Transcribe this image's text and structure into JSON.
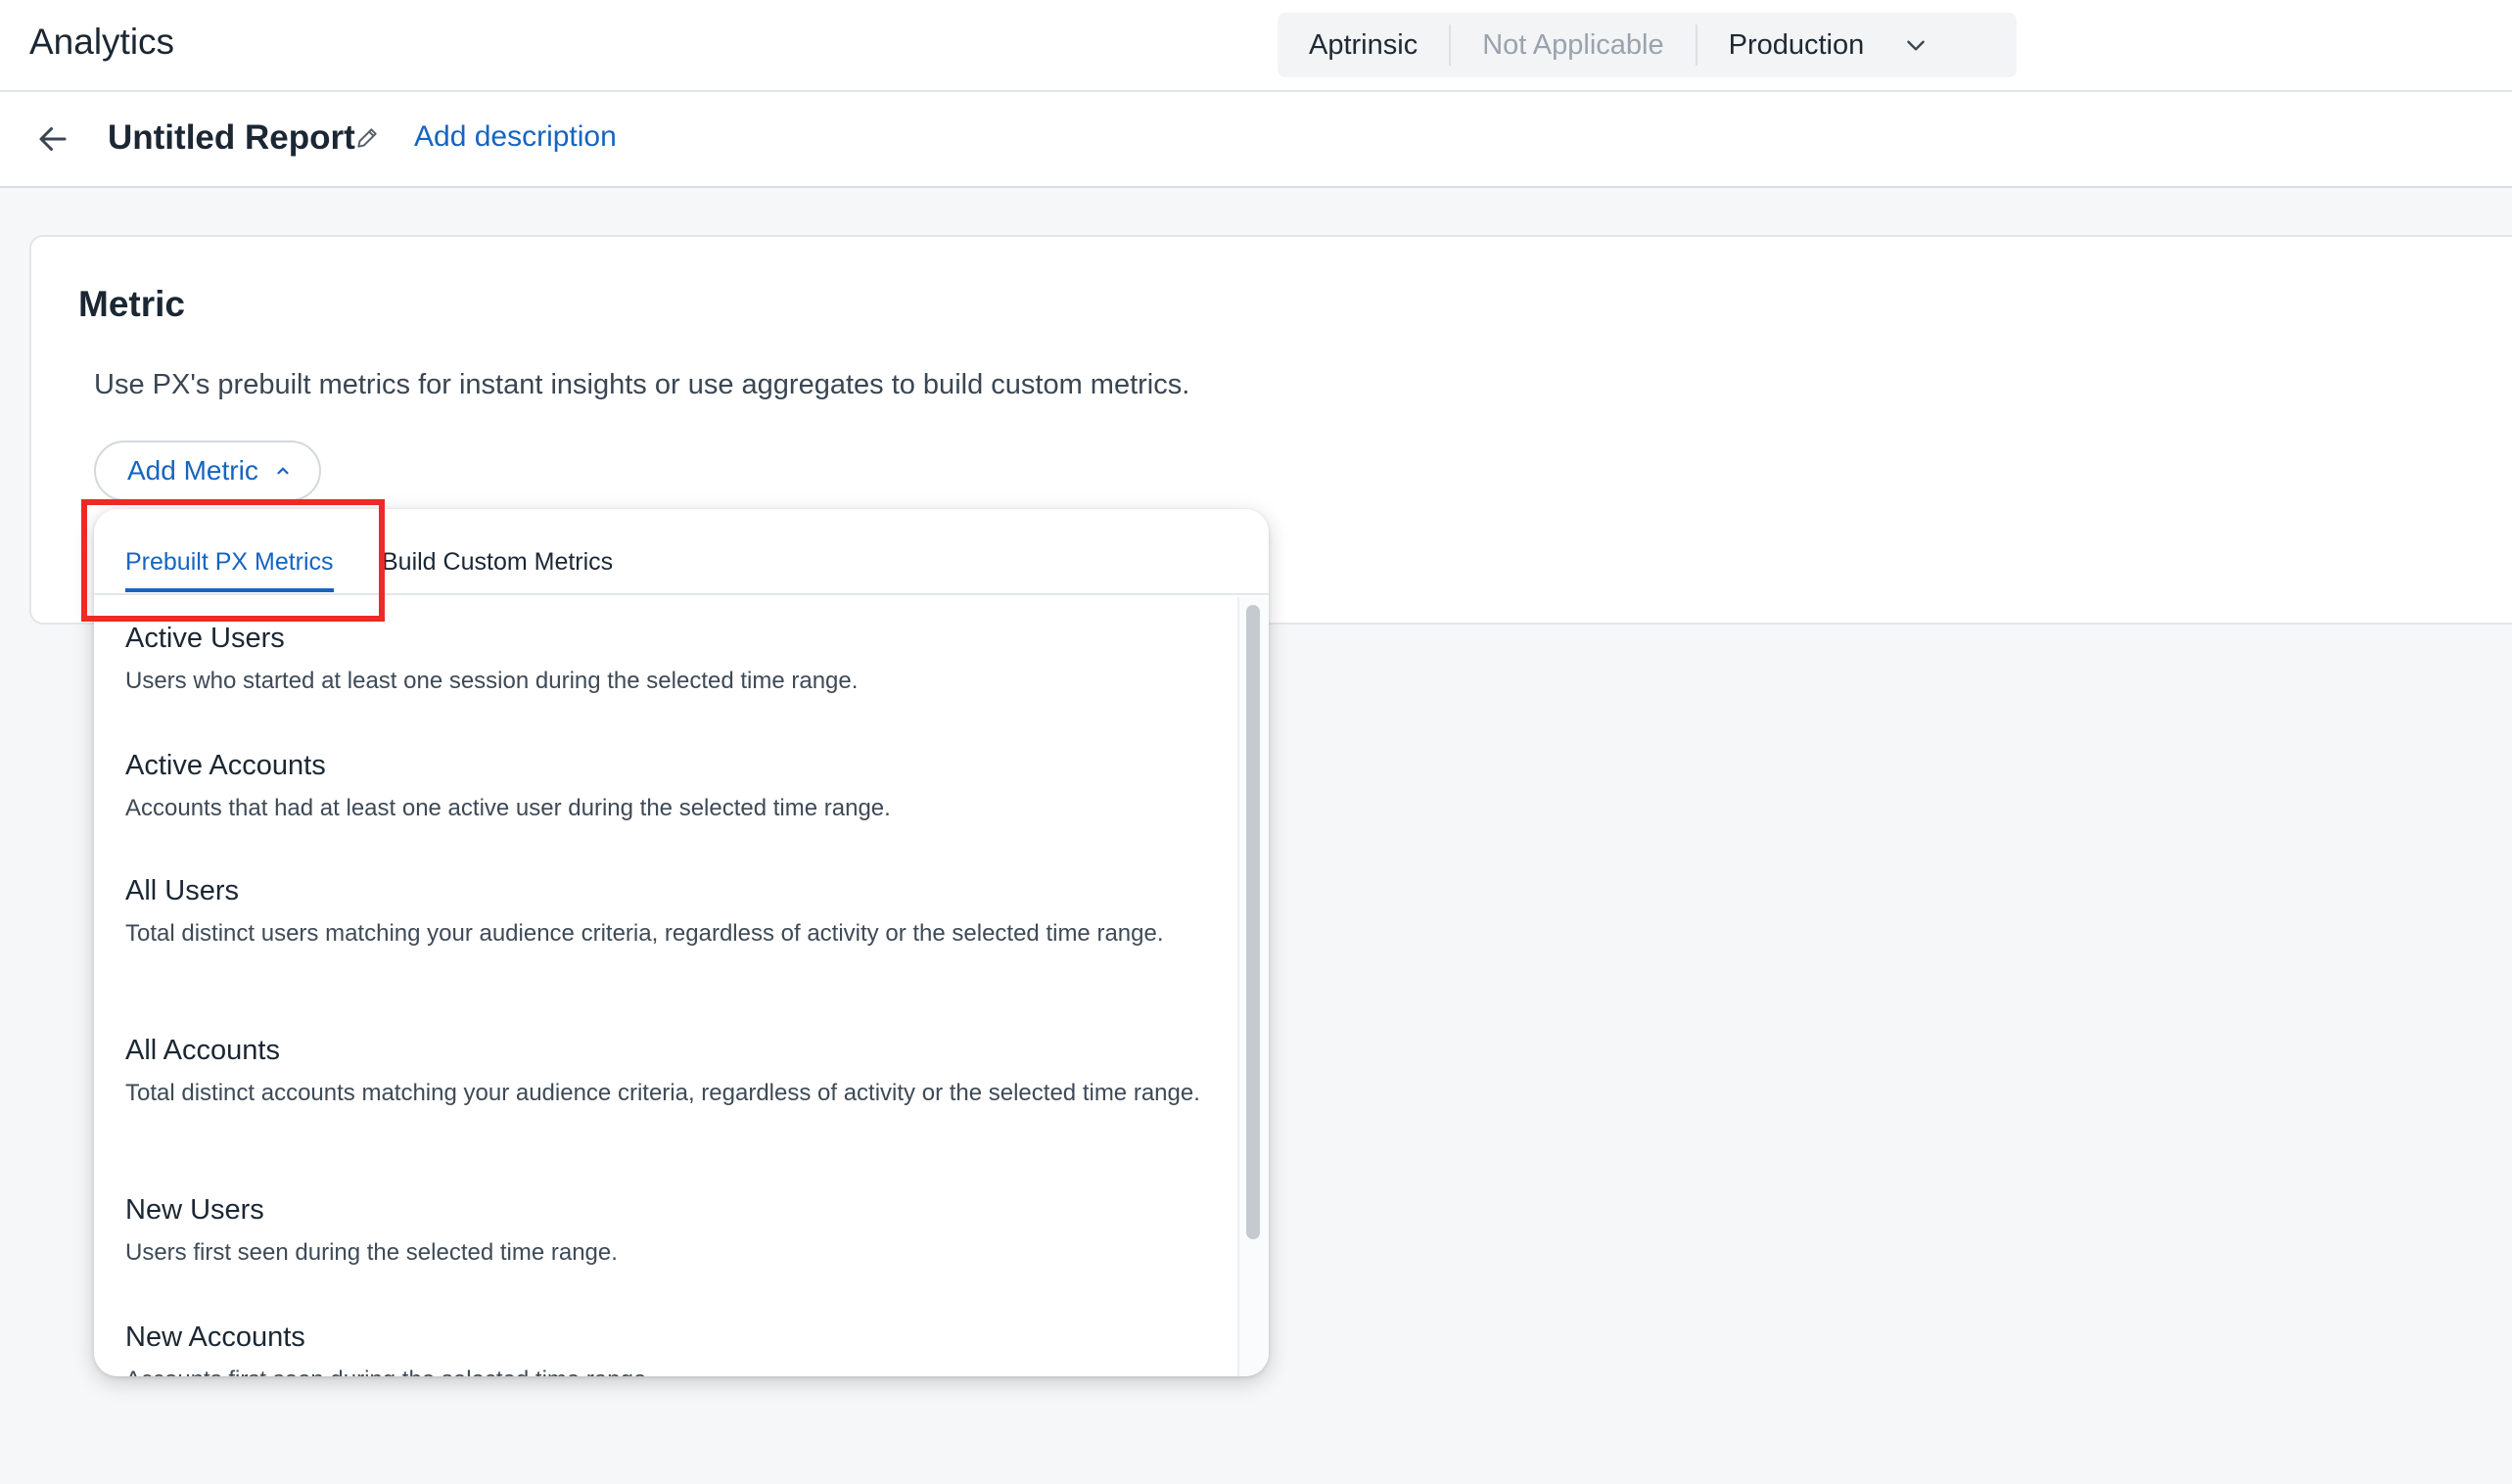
{
  "header": {
    "app_title": "Analytics",
    "context": {
      "product": "Aptrinsic",
      "sub_product": "Not Applicable",
      "environment": "Production",
      "chevron_icon": "chevron-down-icon"
    }
  },
  "report": {
    "back_icon": "arrow-left-icon",
    "title": "Untitled Report",
    "edit_icon": "pencil-icon",
    "add_description": "Add description"
  },
  "metric_card": {
    "title": "Metric",
    "description": "Use PX's prebuilt metrics for instant insights or use aggregates to build custom metrics.",
    "add_metric_label": "Add Metric",
    "add_metric_icon": "chevron-up-icon"
  },
  "dropdown": {
    "tabs": [
      {
        "label": "Prebuilt PX Metrics",
        "active": true
      },
      {
        "label": "Build Custom Metrics",
        "active": false
      }
    ],
    "items": [
      {
        "title": "Active Users",
        "desc": "Users who started at least one session during the selected time range."
      },
      {
        "title": "Active Accounts",
        "desc": "Accounts that had at least one active user during the selected time range."
      },
      {
        "title": "All Users",
        "desc": "Total distinct users matching your audience criteria, regardless of activity or the selected time range."
      },
      {
        "title": "All Accounts",
        "desc": "Total distinct accounts matching your audience criteria, regardless of activity or the selected time range."
      },
      {
        "title": "New Users",
        "desc": "Users first seen during the selected time range."
      },
      {
        "title": "New Accounts",
        "desc": "Accounts first seen during the selected time range."
      }
    ]
  },
  "colors": {
    "accent": "#1565c0",
    "highlight": "#ee2a24",
    "background": "#f5f7f8"
  }
}
